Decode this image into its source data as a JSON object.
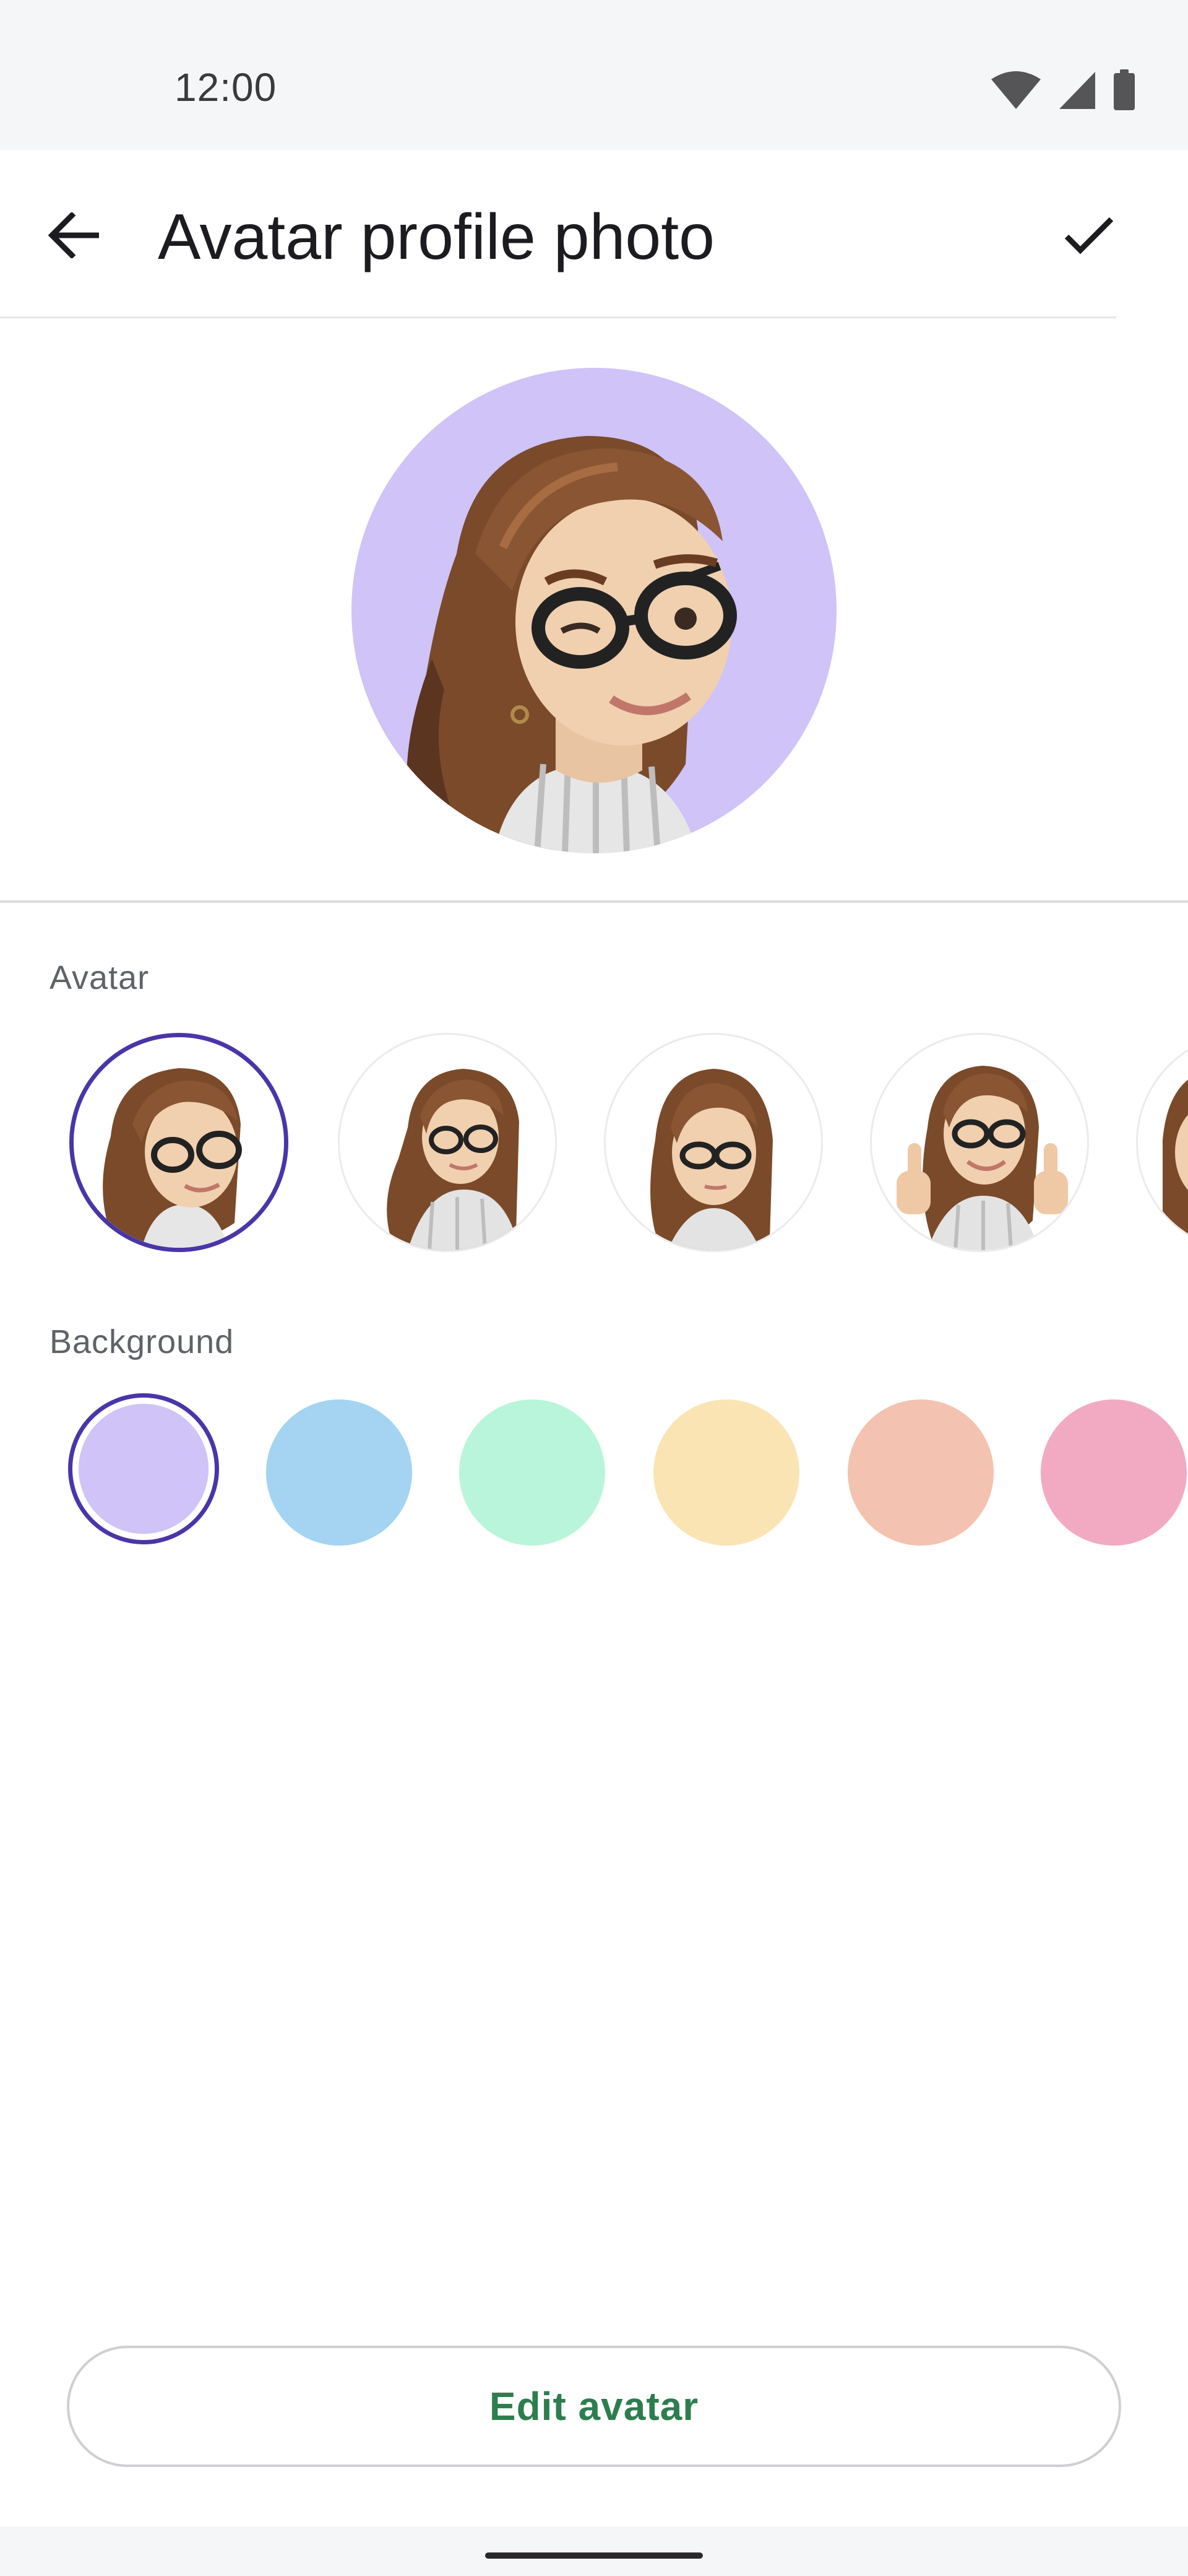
{
  "status_bar": {
    "time": "12:00",
    "icons": [
      "wifi-icon",
      "signal-icon",
      "battery-icon"
    ]
  },
  "app_bar": {
    "title": "Avatar profile photo",
    "back_icon": "arrow-back-icon",
    "confirm_icon": "check-icon"
  },
  "preview": {
    "background_color": "#cfc3f7"
  },
  "avatar_section": {
    "label": "Avatar",
    "selected_index": 0,
    "options": [
      "avatar-wink",
      "avatar-lean",
      "avatar-neutral",
      "avatar-thumbs-up",
      "avatar-partial"
    ]
  },
  "background_section": {
    "label": "Background",
    "selected_index": 0,
    "colors": [
      "#cfc3f7",
      "#a4d4f1",
      "#b9f5da",
      "#fbe4b4",
      "#f4c2b0",
      "#f2aac2"
    ]
  },
  "edit_button": {
    "label": "Edit avatar"
  },
  "colors": {
    "accent": "#4a35a8",
    "button_text": "#2e7d4f"
  }
}
